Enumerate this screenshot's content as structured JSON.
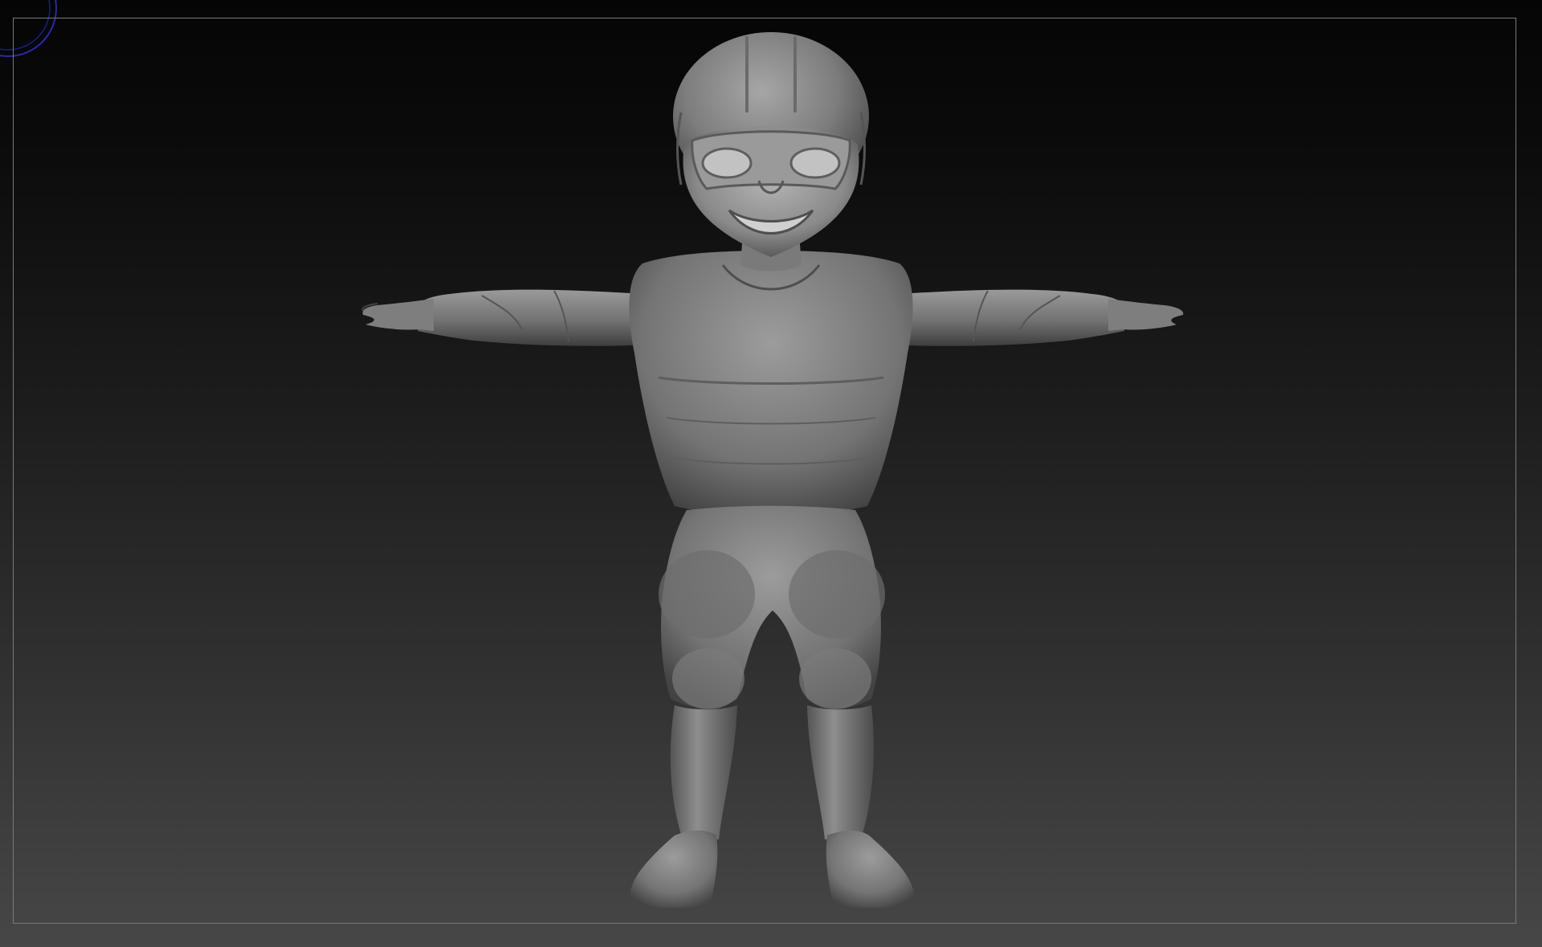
{
  "app": {
    "accent_color": "#2a2aa8",
    "frame_color": "#7a7a7a",
    "clay_color": "#8a8a8a"
  },
  "viewport": {
    "icons": {
      "gizmo": "navigation-gizmo-icon"
    },
    "model": {
      "icon": "sculpt-model-figure"
    }
  }
}
